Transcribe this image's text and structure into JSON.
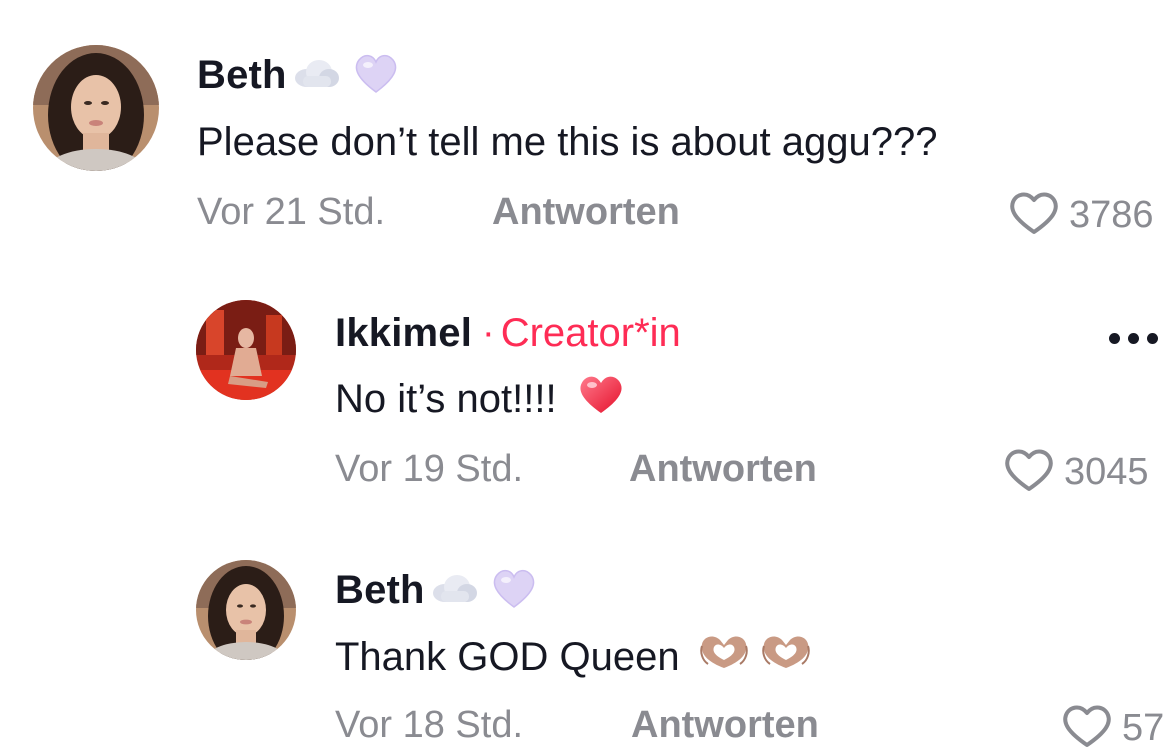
{
  "comments": [
    {
      "username": "Beth",
      "text": "Please don’t tell me this is about aggu???",
      "time": "Vor 21 Std.",
      "reply_label": "Antworten",
      "likes": "3786",
      "emojis": [
        "cloud-emoji",
        "purple-heart-emoji"
      ]
    },
    {
      "username": "Ikkimel",
      "badge_separator": "·",
      "badge": "Creator*in",
      "text": "No it’s not!!!!",
      "time": "Vor 19 Std.",
      "reply_label": "Antworten",
      "likes": "3045",
      "text_emoji": "red-heart-emoji"
    },
    {
      "username": "Beth",
      "text": "Thank GOD Queen",
      "time": "Vor 18 Std.",
      "reply_label": "Antworten",
      "likes": "57",
      "emojis": [
        "cloud-emoji",
        "purple-heart-emoji"
      ],
      "text_emojis": [
        "heart-hands-emoji",
        "heart-hands-emoji"
      ]
    }
  ],
  "colors": {
    "creator_accent": "#fe2c55",
    "meta_gray": "#8a8b91",
    "text_dark": "#161823"
  }
}
